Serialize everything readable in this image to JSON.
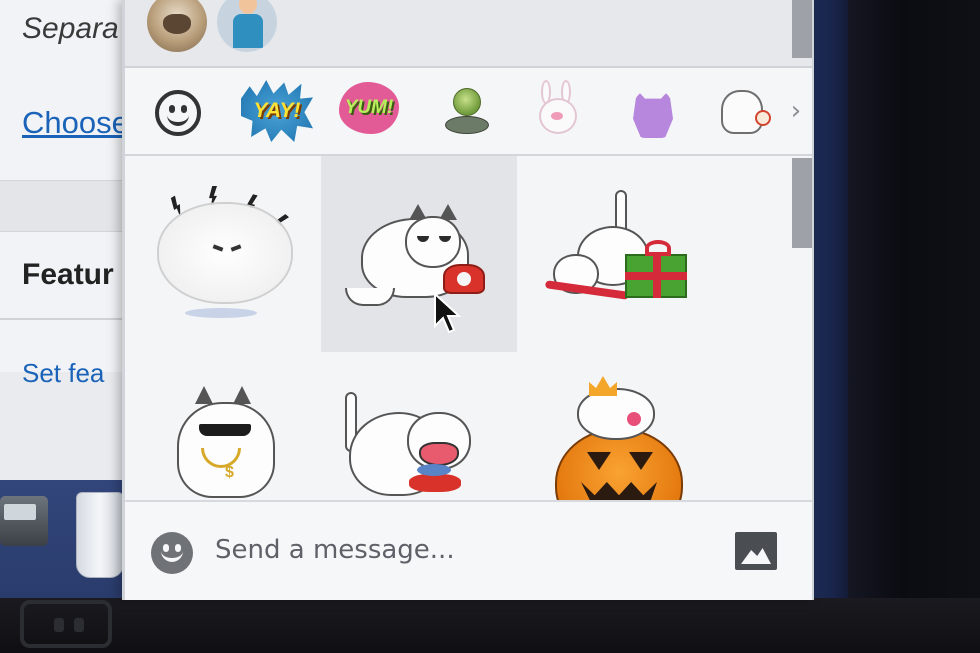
{
  "background_page": {
    "separator_text": "Separa",
    "choose_link": "Choose",
    "featured_heading": "Featur",
    "set_featured_link": "Set fea"
  },
  "avatars": [
    {
      "name": "avatar-bulldog"
    },
    {
      "name": "avatar-person"
    }
  ],
  "sticker_packs": [
    {
      "id": "emoji",
      "label": ""
    },
    {
      "id": "yay",
      "label": "YAY!"
    },
    {
      "id": "yum",
      "label": "YUM!"
    },
    {
      "id": "alien",
      "label": ""
    },
    {
      "id": "rabbit",
      "label": ""
    },
    {
      "id": "purple-cat",
      "label": ""
    },
    {
      "id": "white-cat",
      "label": ""
    }
  ],
  "pack_next_label": "›",
  "stickers": [
    {
      "id": "fluffy-angry-cat"
    },
    {
      "id": "cat-with-phone"
    },
    {
      "id": "cat-with-gift"
    },
    {
      "id": "cool-cat-sunglasses"
    },
    {
      "id": "cat-eating-fish"
    },
    {
      "id": "cat-in-pumpkin"
    }
  ],
  "composer": {
    "placeholder": "Send a message...",
    "value": ""
  },
  "colors": {
    "popup_bg": "#f2f3f5",
    "link_blue": "#1a63b8",
    "hover_cell": "#e2e4e8",
    "icon_grey": "#6f7277"
  }
}
